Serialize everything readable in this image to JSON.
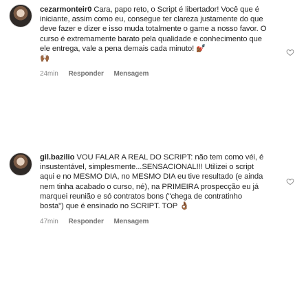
{
  "comments": [
    {
      "username": "cezarmonteir0",
      "text": "Cara, papo reto, o Script é libertador! Você que é iniciante, assim como eu, consegue ter clareza justamente do que deve fazer e dizer e isso muda totalmente o game a nosso favor. O curso é extremamente barato pela qualidade e conhecimento que ele entrega, vale a pena demais cada minuto! ",
      "emoji_inline": "💅🏾",
      "emoji_line": "🙌🏾",
      "time": "24min",
      "reply_label": "Responder",
      "message_label": "Mensagem",
      "heart_icon": "heart-outline-icon"
    },
    {
      "username": "gil.bazilio",
      "text": "VOU FALAR A REAL DO SCRIPT: não tem como véi, é insustentável, simplesmente...SENSACIONAL!!! Utilizei o script aqui e no MESMO DIA, no MESMO DIA eu tive resultado (e ainda nem tinha acabado o curso, né), na PRIMEIRA prospecção eu já marquei reunião e só contratos bons (\"chega de contratinho bosta\") que é ensinado no SCRIPT. TOP ",
      "emoji_inline": "👌🏾",
      "time": "47min",
      "reply_label": "Responder",
      "message_label": "Mensagem",
      "heart_icon": "heart-outline-icon"
    }
  ]
}
